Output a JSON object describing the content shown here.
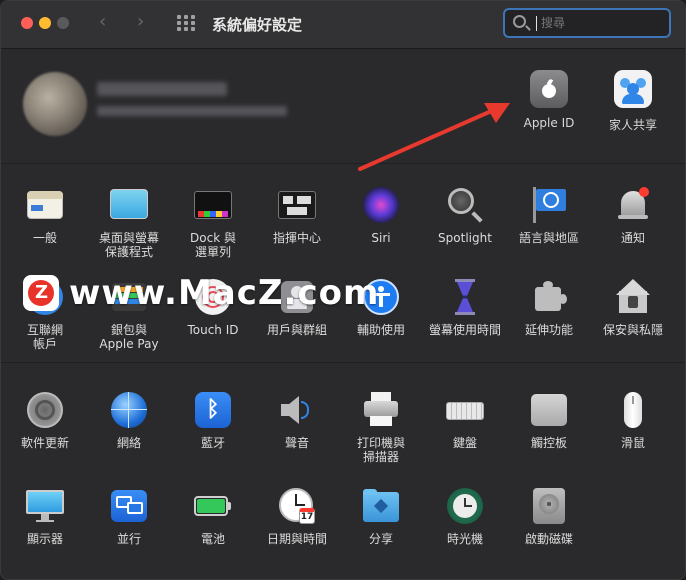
{
  "window": {
    "title": "系統偏好設定"
  },
  "search": {
    "placeholder": "搜尋"
  },
  "account": {
    "tiles": [
      {
        "label": "Apple ID",
        "icon": "apple-icon"
      },
      {
        "label": "家人共享",
        "icon": "family-sharing-icon"
      }
    ]
  },
  "watermark": {
    "text": "www.MacZ.com"
  },
  "section1": [
    {
      "line1": "一般",
      "line2": "",
      "icon": "general-icon"
    },
    {
      "line1": "桌面與螢幕",
      "line2": "保護程式",
      "icon": "desktop-screensaver-icon"
    },
    {
      "line1": "Dock 與",
      "line2": "選單列",
      "icon": "dock-icon"
    },
    {
      "line1": "指揮中心",
      "line2": "",
      "icon": "mission-control-icon"
    },
    {
      "line1": "Siri",
      "line2": "",
      "icon": "siri-icon"
    },
    {
      "line1": "Spotlight",
      "line2": "",
      "icon": "spotlight-icon"
    },
    {
      "line1": "語言與地區",
      "line2": "",
      "icon": "language-region-icon"
    },
    {
      "line1": "通知",
      "line2": "",
      "icon": "notifications-icon"
    },
    {
      "line1": "互聯網",
      "line2": "帳戶",
      "icon": "internet-accounts-icon"
    },
    {
      "line1": "銀包與",
      "line2": "Apple Pay",
      "icon": "wallet-icon"
    },
    {
      "line1": "Touch ID",
      "line2": "",
      "icon": "touch-id-icon"
    },
    {
      "line1": "用戶與群組",
      "line2": "",
      "icon": "users-groups-icon"
    },
    {
      "line1": "輔助使用",
      "line2": "",
      "icon": "accessibility-icon"
    },
    {
      "line1": "螢幕使用時間",
      "line2": "",
      "icon": "screen-time-icon"
    },
    {
      "line1": "延伸功能",
      "line2": "",
      "icon": "extensions-icon"
    },
    {
      "line1": "保安與私隱",
      "line2": "",
      "icon": "security-privacy-icon"
    }
  ],
  "section2": [
    {
      "line1": "軟件更新",
      "line2": "",
      "icon": "software-update-icon"
    },
    {
      "line1": "網絡",
      "line2": "",
      "icon": "network-icon"
    },
    {
      "line1": "藍牙",
      "line2": "",
      "icon": "bluetooth-icon"
    },
    {
      "line1": "聲音",
      "line2": "",
      "icon": "sound-icon"
    },
    {
      "line1": "打印機與",
      "line2": "掃描器",
      "icon": "printers-scanners-icon"
    },
    {
      "line1": "鍵盤",
      "line2": "",
      "icon": "keyboard-icon"
    },
    {
      "line1": "觸控板",
      "line2": "",
      "icon": "trackpad-icon"
    },
    {
      "line1": "滑鼠",
      "line2": "",
      "icon": "mouse-icon"
    },
    {
      "line1": "顯示器",
      "line2": "",
      "icon": "displays-icon"
    },
    {
      "line1": "並行",
      "line2": "",
      "icon": "sidecar-icon"
    },
    {
      "line1": "電池",
      "line2": "",
      "icon": "battery-icon"
    },
    {
      "line1": "日期與時間",
      "line2": "",
      "icon": "date-time-icon"
    },
    {
      "line1": "分享",
      "line2": "",
      "icon": "sharing-icon"
    },
    {
      "line1": "時光機",
      "line2": "",
      "icon": "time-machine-icon"
    },
    {
      "line1": "啟動磁碟",
      "line2": "",
      "icon": "startup-disk-icon"
    }
  ],
  "date_icon_day": "17"
}
